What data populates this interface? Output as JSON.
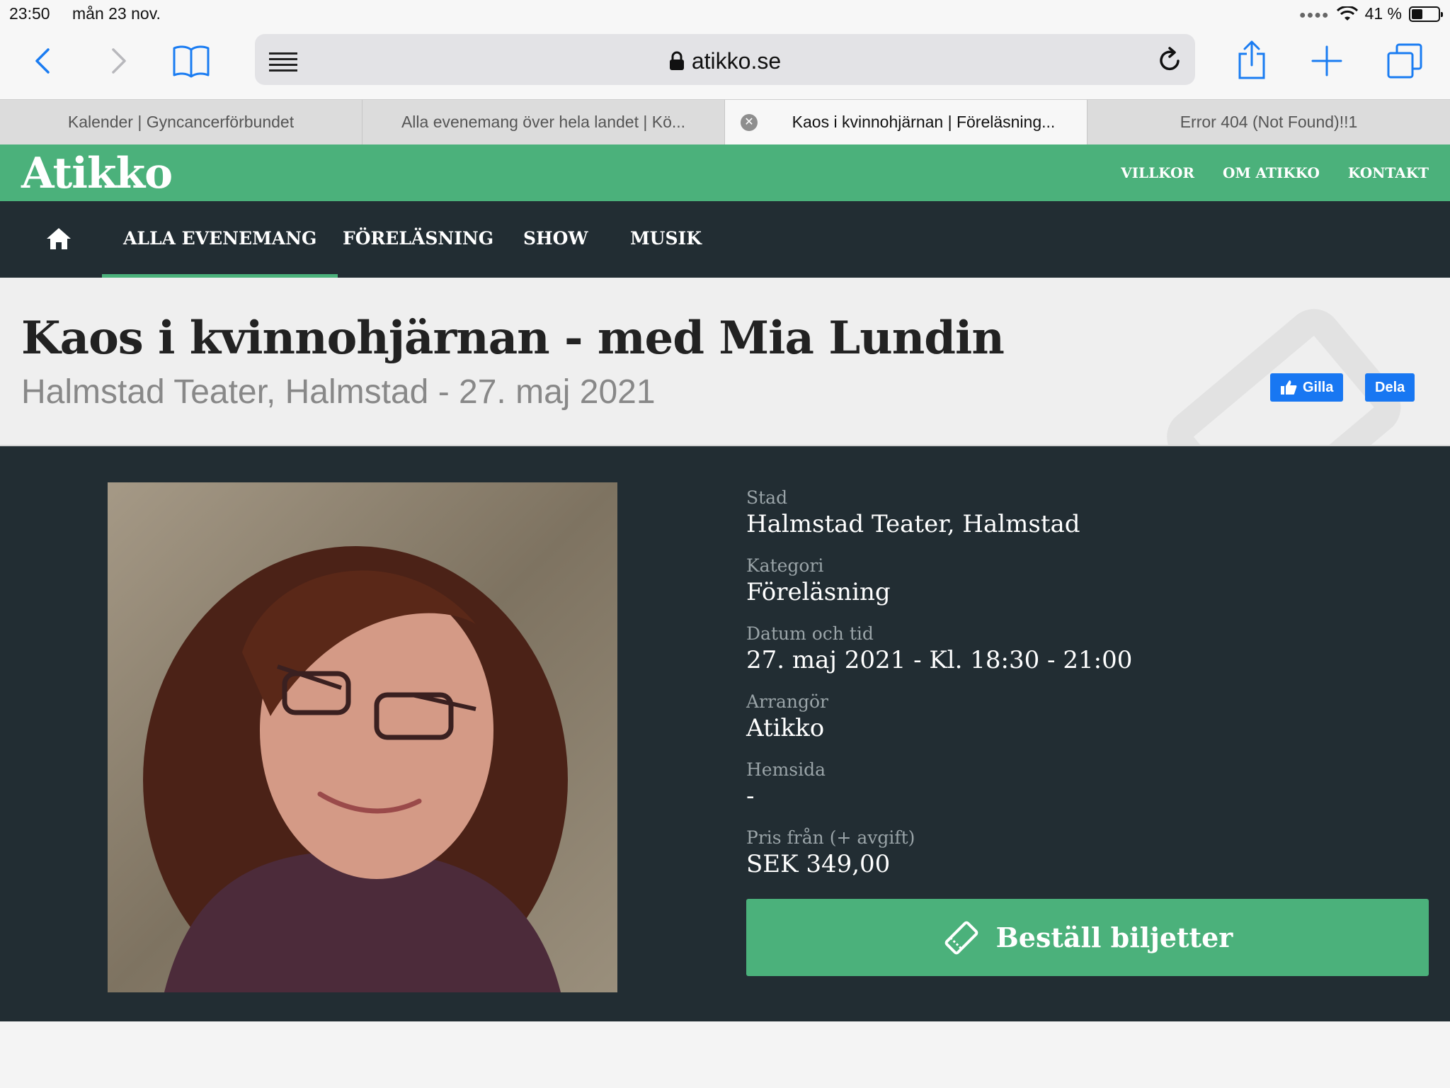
{
  "status_bar": {
    "time": "23:50",
    "date": "mån 23 nov.",
    "battery": "41 %",
    "battery_level": 0.41
  },
  "browser": {
    "url": "atikko.se",
    "tabs": [
      {
        "label": "Kalender | Gyncancerförbundet"
      },
      {
        "label": "Alla evenemang över hela landet | Kö..."
      },
      {
        "label": "Kaos i kvinnohjärnan | Föreläsning..."
      },
      {
        "label": "Error 404 (Not Found)!!1"
      }
    ],
    "active_tab_index": 2,
    "accent_color": "#1a7cf2"
  },
  "site": {
    "logo": "Atikko",
    "brand_color": "#4bb17b",
    "dark_color": "#222d33",
    "top_nav": [
      "VILLKOR",
      "OM ATIKKO",
      "KONTAKT"
    ],
    "main_nav": [
      "ALLA EVENEMANG",
      "FÖRELÄSNING",
      "SHOW",
      "MUSIK"
    ],
    "active_nav": "ALLA EVENEMANG"
  },
  "event": {
    "title": "Kaos i kvinnohjärnan - med Mia Lundin",
    "subtitle": "Halmstad Teater, Halmstad - 27. maj 2021",
    "like_label": "Gilla",
    "share_label": "Dela",
    "details": [
      {
        "label": "Stad",
        "value": "Halmstad Teater, Halmstad"
      },
      {
        "label": "Kategori",
        "value": "Föreläsning"
      },
      {
        "label": "Datum och tid",
        "value": "27. maj 2021 - Kl. 18:30 - 21:00"
      },
      {
        "label": "Arrangör",
        "value": "Atikko"
      },
      {
        "label": "Hemsida",
        "value": "-"
      },
      {
        "label": "Pris från (+ avgift)",
        "value": "SEK 349,00"
      }
    ],
    "cta_label": "Beställ biljetter"
  }
}
